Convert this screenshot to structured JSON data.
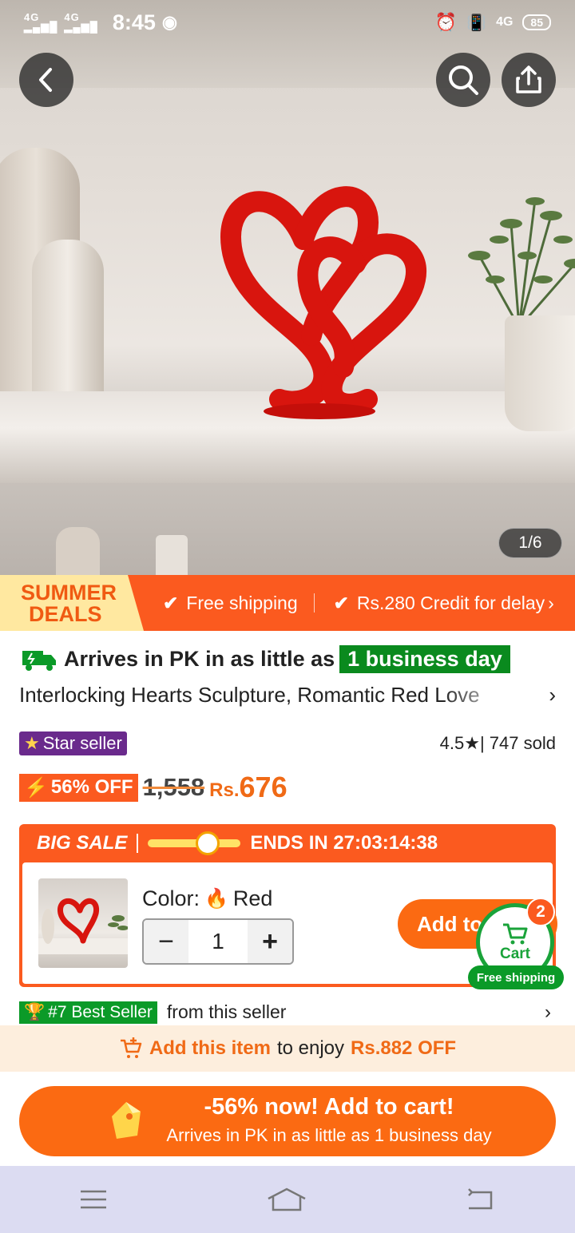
{
  "status_bar": {
    "network1": "4G",
    "network2": "4G",
    "time": "8:45",
    "right_network": "4G",
    "battery": "85"
  },
  "gallery": {
    "pager": "1/6"
  },
  "promo": {
    "summer_line1": "SUMMER",
    "summer_line2": "DEALS",
    "free_shipping": "Free shipping",
    "credit": "Rs.280 Credit for delay"
  },
  "product": {
    "arrives_text": "Arrives in PK in as little as",
    "arrives_badge": "1 business day",
    "title": "Interlocking Hearts Sculpture, Romantic Red Love",
    "star_seller": "Star seller",
    "rating": "4.5",
    "sold": "| 747 sold",
    "discount": "56% OFF",
    "old_price": "1,558",
    "currency": "Rs.",
    "price": "676"
  },
  "big_sale": {
    "label": "BIG SALE",
    "progress": 0.65,
    "ends_label": "ENDS IN 27:03:14:38",
    "color_label": "Color:",
    "color_value": "Red",
    "quantity": "1",
    "add_label": "Add to cart"
  },
  "cart": {
    "label": "Cart",
    "count": "2",
    "free_shipping": "Free shipping"
  },
  "best_seller": {
    "badge": "#7 Best Seller",
    "text": "from this seller"
  },
  "add_bar": {
    "part1": "Add this item",
    "part2": "to enjoy",
    "part3": "Rs.882 OFF"
  },
  "cta": {
    "line1": "-56% now! Add to cart!",
    "line2": "Arrives in PK in as little as 1 business day"
  },
  "colors": {
    "accent": "#fb5a1f",
    "green": "#0b9a28",
    "purple": "#6a2a8c"
  }
}
